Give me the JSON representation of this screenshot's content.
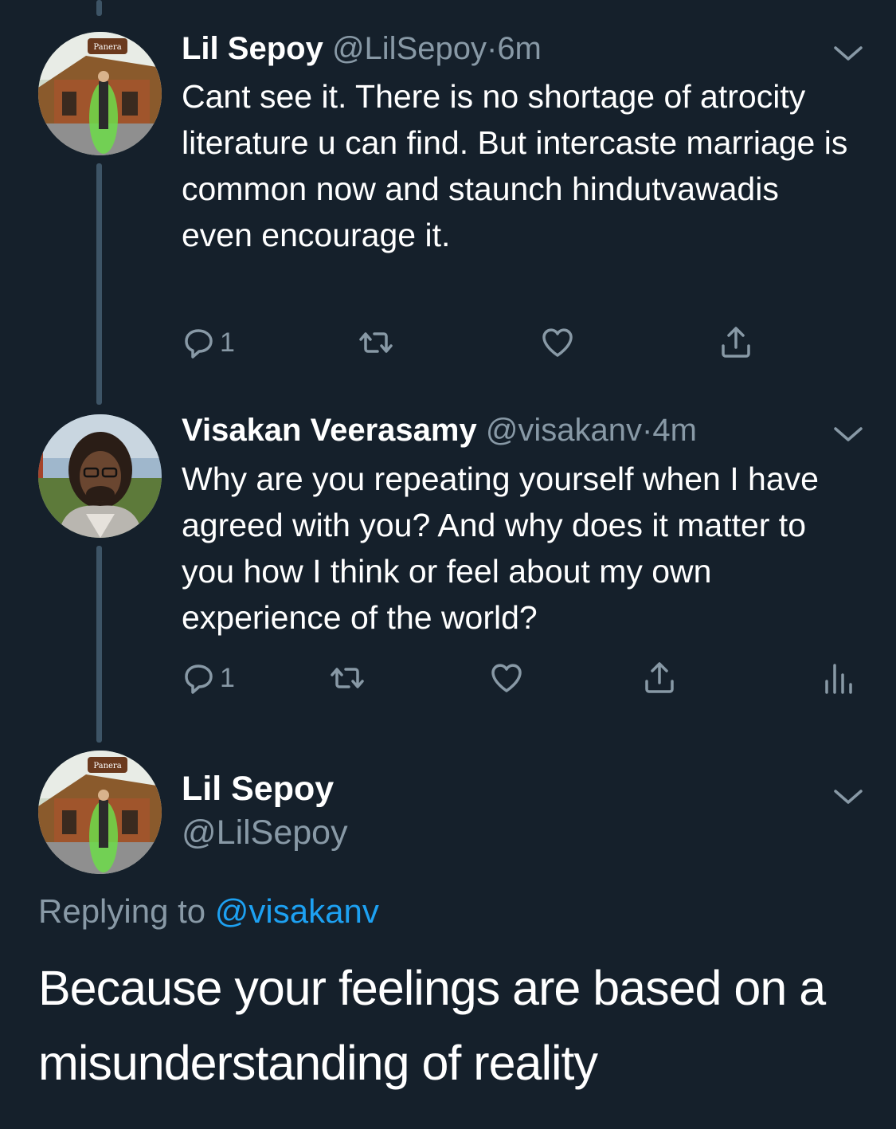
{
  "tweets": [
    {
      "name": "Lil Sepoy",
      "handle": "@LilSepoy",
      "separator": "·",
      "time": "6m",
      "text": "Cant see it. There is no shortage of atrocity literature u can find. But intercaste marriage is common now and staunch hindutvawadis even encourage it.",
      "reply_count": "1"
    },
    {
      "name": "Visakan Veerasamy",
      "handle": "@visakanv",
      "separator": "·",
      "time": "4m",
      "text": "Why are you repeating yourself when I have agreed with you? And why does it matter to you how I think or feel about my own experience of the world?",
      "reply_count": "1"
    }
  ],
  "main": {
    "name": "Lil Sepoy",
    "handle": "@LilSepoy",
    "replying_prefix": "Replying to",
    "replying_to": "@visakanv",
    "text": "Because your feelings are based on a misunderstanding of reality"
  },
  "icons": {
    "reply": "reply-icon",
    "retweet": "retweet-icon",
    "like": "heart-icon",
    "share": "share-icon",
    "analytics": "analytics-icon",
    "more": "chevron-down-icon"
  },
  "colors": {
    "background": "#15202b",
    "text": "#ffffff",
    "secondary": "#8899a6",
    "link": "#1da1f2",
    "thread_line": "#3d5466"
  }
}
